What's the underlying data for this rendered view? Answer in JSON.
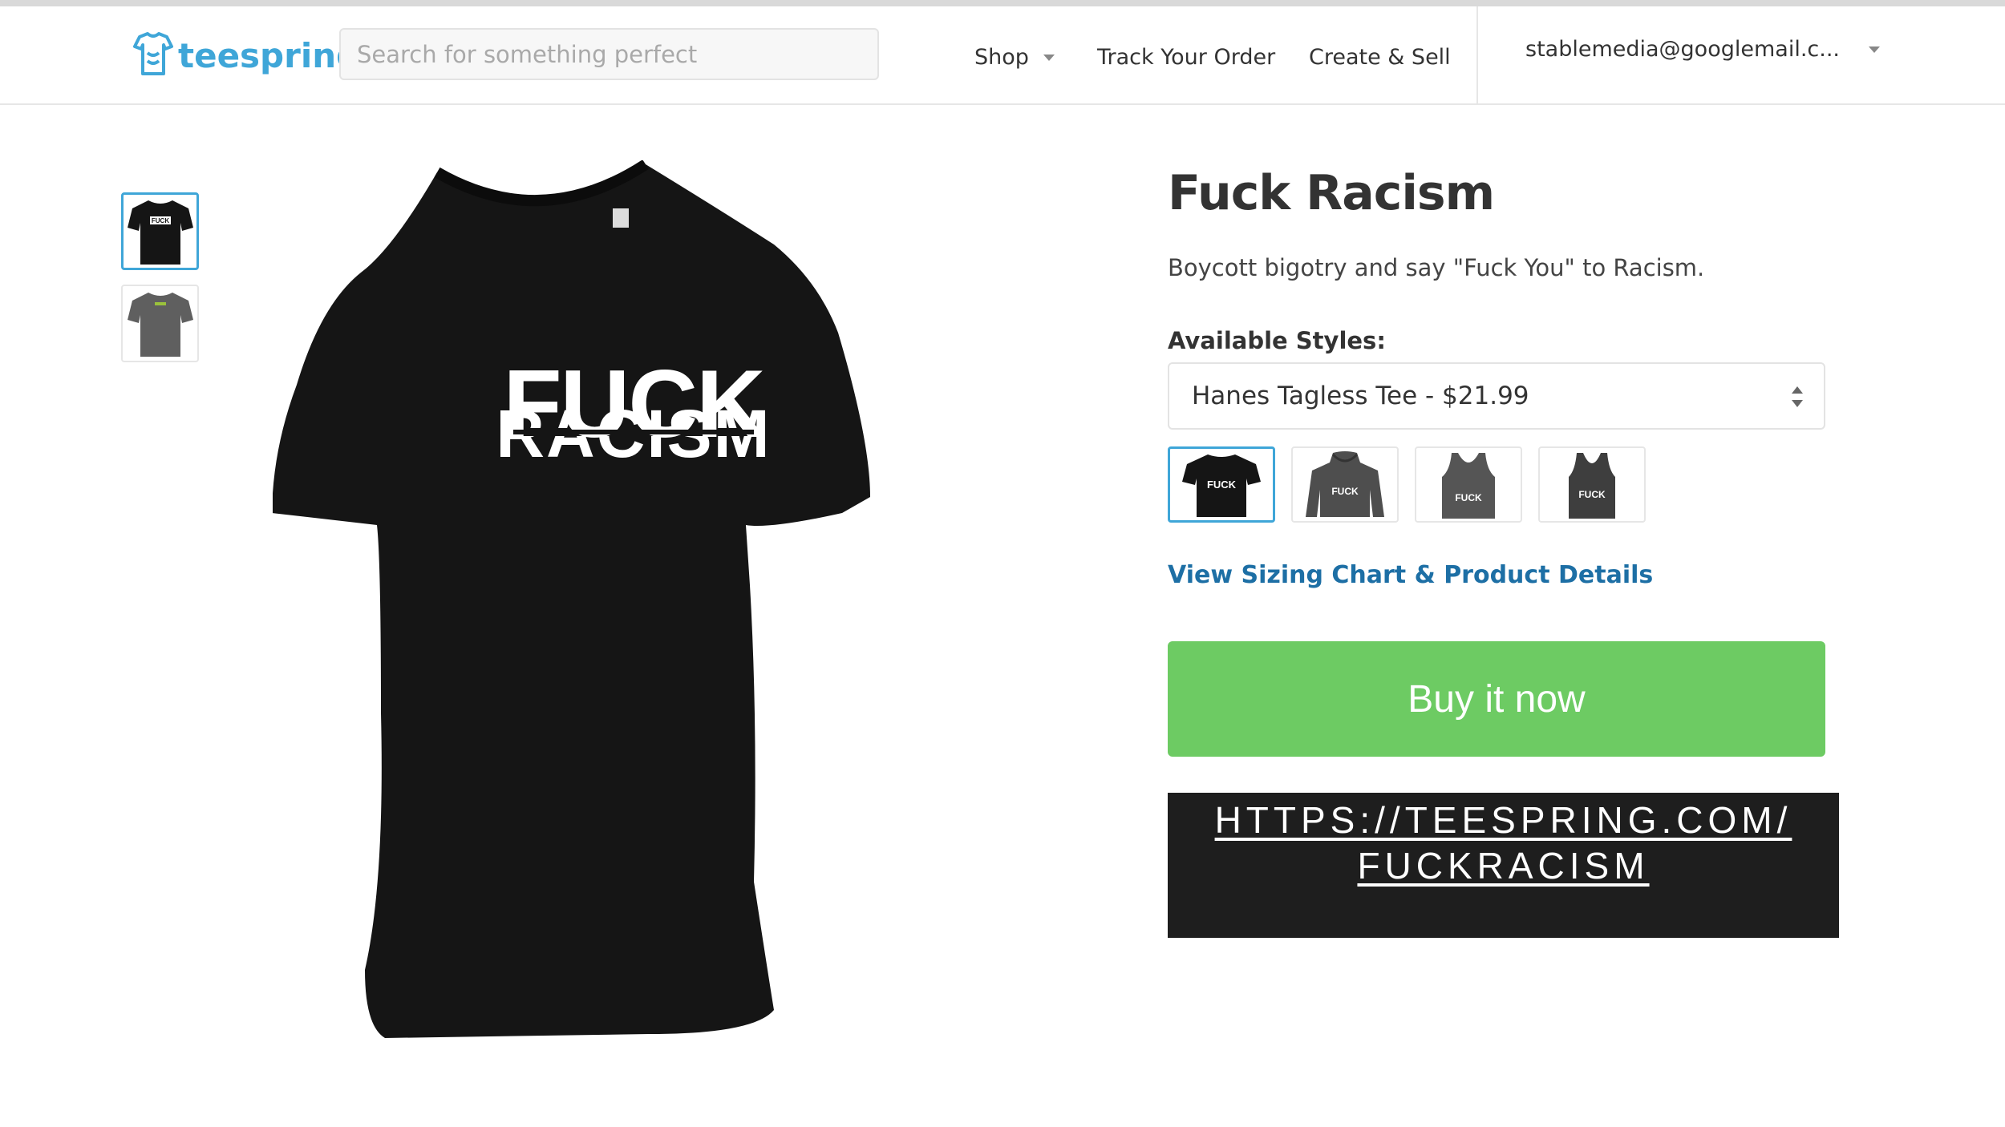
{
  "header": {
    "logo_text": "teespring",
    "search_placeholder": "Search for something perfect",
    "nav": {
      "shop": "Shop",
      "track": "Track Your Order",
      "create": "Create & Sell"
    },
    "account": "stablemedia@googlemail.c..."
  },
  "gallery": {
    "thumbs": [
      {
        "color": "#151515",
        "print": "FUCK"
      },
      {
        "color": "#5f5f5f",
        "print": ""
      }
    ],
    "main_print_top": "FUCK",
    "main_print_bottom": "RACISM",
    "shirt_color": "#151515"
  },
  "product": {
    "title": "Fuck Racism",
    "description": "Boycott bigotry and say \"Fuck You\" to Racism.",
    "styles_label": "Available Styles:",
    "selected_style": "Hanes Tagless Tee - $21.99",
    "swatches": [
      {
        "type": "tee",
        "color": "#151515",
        "print": "FUCK"
      },
      {
        "type": "hoodie",
        "color": "#4e4e4e",
        "print": "FUCK"
      },
      {
        "type": "tank",
        "color": "#555555",
        "print": "FUCK"
      },
      {
        "type": "tank",
        "color": "#3e3e3e",
        "print": "FUCK"
      }
    ],
    "sizing_link": "View Sizing Chart & Product Details",
    "buy_label": "Buy it now"
  },
  "url_banner": {
    "line1": "HTTPS://TEESPRING.COM/",
    "line2": "FUCKRACISM"
  },
  "colors": {
    "accent": "#3fa6d8",
    "link": "#1d6fa5",
    "buy_button": "#6dcb63",
    "banner_bg": "#1e1e1e"
  }
}
